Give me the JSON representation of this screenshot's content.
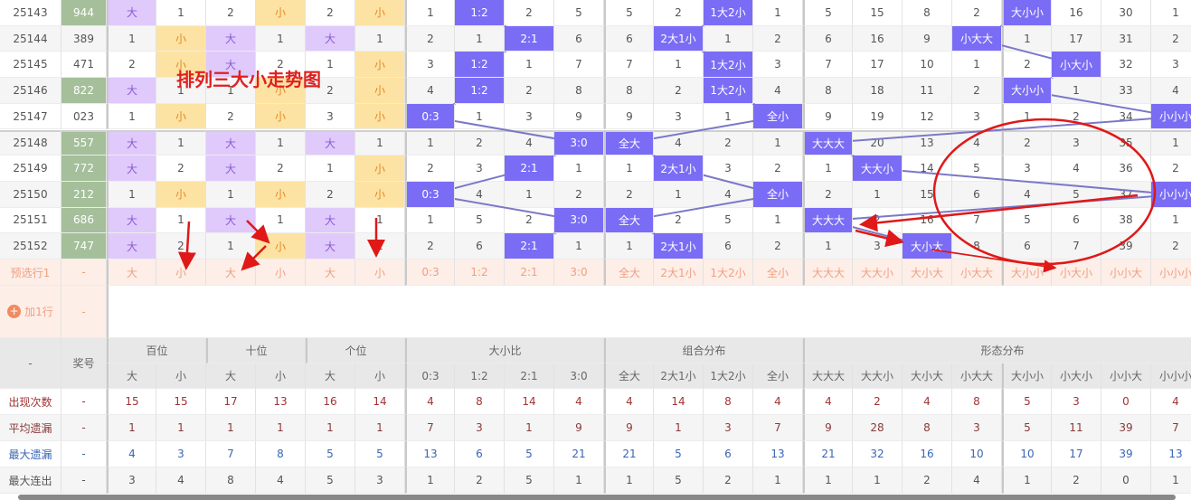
{
  "title": "排列三大小走势图",
  "rows": [
    {
      "issue": "25143",
      "number": "944",
      "green": true,
      "cells": [
        "大",
        "1",
        "2",
        "小",
        "2",
        "小",
        "1",
        "1:2",
        "2",
        "5",
        "5",
        "2",
        "1大2小",
        "1",
        "5",
        "15",
        "8",
        "2",
        "大小小",
        "16",
        "30",
        "1"
      ]
    },
    {
      "issue": "25144",
      "number": "389",
      "green": false,
      "cells": [
        "1",
        "小",
        "大",
        "1",
        "大",
        "1",
        "2",
        "1",
        "2:1",
        "6",
        "6",
        "2大1小",
        "1",
        "2",
        "6",
        "16",
        "9",
        "小大大",
        "1",
        "17",
        "31",
        "2"
      ]
    },
    {
      "issue": "25145",
      "number": "471",
      "green": false,
      "cells": [
        "2",
        "小",
        "大",
        "2",
        "1",
        "小",
        "3",
        "1:2",
        "1",
        "7",
        "7",
        "1",
        "1大2小",
        "3",
        "7",
        "17",
        "10",
        "1",
        "2",
        "小大小",
        "32",
        "3"
      ]
    },
    {
      "issue": "25146",
      "number": "822",
      "green": true,
      "cells": [
        "大",
        "1",
        "1",
        "小",
        "2",
        "小",
        "4",
        "1:2",
        "2",
        "8",
        "8",
        "2",
        "1大2小",
        "4",
        "8",
        "18",
        "11",
        "2",
        "大小小",
        "1",
        "33",
        "4"
      ]
    },
    {
      "issue": "25147",
      "number": "023",
      "green": false,
      "cells": [
        "1",
        "小",
        "2",
        "小",
        "3",
        "小",
        "0:3",
        "1",
        "3",
        "9",
        "9",
        "3",
        "1",
        "全小",
        "9",
        "19",
        "12",
        "3",
        "1",
        "2",
        "34",
        "小小小"
      ]
    },
    {
      "issue": "25148",
      "number": "557",
      "green": true,
      "cells": [
        "大",
        "1",
        "大",
        "1",
        "大",
        "1",
        "1",
        "2",
        "4",
        "3:0",
        "全大",
        "4",
        "2",
        "1",
        "大大大",
        "20",
        "13",
        "4",
        "2",
        "3",
        "35",
        "1"
      ]
    },
    {
      "issue": "25149",
      "number": "772",
      "green": true,
      "cells": [
        "大",
        "2",
        "大",
        "2",
        "1",
        "小",
        "2",
        "3",
        "2:1",
        "1",
        "1",
        "2大1小",
        "3",
        "2",
        "1",
        "大大小",
        "14",
        "5",
        "3",
        "4",
        "36",
        "2"
      ]
    },
    {
      "issue": "25150",
      "number": "212",
      "green": true,
      "cells": [
        "1",
        "小",
        "1",
        "小",
        "2",
        "小",
        "0:3",
        "4",
        "1",
        "2",
        "2",
        "1",
        "4",
        "全小",
        "2",
        "1",
        "15",
        "6",
        "4",
        "5",
        "37",
        "小小小"
      ]
    },
    {
      "issue": "25151",
      "number": "686",
      "green": true,
      "cells": [
        "大",
        "1",
        "大",
        "1",
        "大",
        "1",
        "1",
        "5",
        "2",
        "3:0",
        "全大",
        "2",
        "5",
        "1",
        "大大大",
        "2",
        "16",
        "7",
        "5",
        "6",
        "38",
        "1"
      ]
    },
    {
      "issue": "25152",
      "number": "747",
      "green": true,
      "cells": [
        "大",
        "2",
        "1",
        "小",
        "大",
        "2",
        "2",
        "6",
        "2:1",
        "1",
        "1",
        "2大1小",
        "6",
        "2",
        "1",
        "3",
        "大小大",
        "8",
        "6",
        "7",
        "39",
        "2"
      ]
    }
  ],
  "preselect": {
    "label": "预选行1",
    "number": "-",
    "cells": [
      "大",
      "小",
      "大",
      "小",
      "大",
      "小",
      "0:3",
      "1:2",
      "2:1",
      "3:0",
      "全大",
      "2大1小",
      "1大2小",
      "全小",
      "大大大",
      "大大小",
      "大小大",
      "小大大",
      "大小小",
      "小大小",
      "小小大",
      "小小小"
    ]
  },
  "add_row": {
    "label": "加1行",
    "number": "-"
  },
  "header": {
    "corner": "-",
    "number": "奖号",
    "groups": [
      "百位",
      "十位",
      "个位",
      "大小比",
      "组合分布",
      "形态分布"
    ],
    "sub": [
      "大",
      "小",
      "大",
      "小",
      "大",
      "小",
      "0:3",
      "1:2",
      "2:1",
      "3:0",
      "全大",
      "2大1小",
      "1大2小",
      "全小",
      "大大大",
      "大大小",
      "大小大",
      "小大大",
      "大小小",
      "小大小",
      "小小大",
      "小小小"
    ]
  },
  "stats": [
    {
      "label": "出现次数",
      "number": "-",
      "values": [
        "15",
        "15",
        "17",
        "13",
        "16",
        "14",
        "4",
        "8",
        "14",
        "4",
        "4",
        "14",
        "8",
        "4",
        "4",
        "2",
        "4",
        "8",
        "5",
        "3",
        "0",
        "4"
      ]
    },
    {
      "label": "平均遗漏",
      "number": "-",
      "values": [
        "1",
        "1",
        "1",
        "1",
        "1",
        "1",
        "7",
        "3",
        "1",
        "9",
        "9",
        "1",
        "3",
        "7",
        "9",
        "28",
        "8",
        "3",
        "5",
        "11",
        "39",
        "7"
      ]
    },
    {
      "label": "最大遗漏",
      "number": "-",
      "values": [
        "4",
        "3",
        "7",
        "8",
        "5",
        "5",
        "13",
        "6",
        "5",
        "21",
        "21",
        "5",
        "6",
        "13",
        "21",
        "32",
        "16",
        "10",
        "10",
        "17",
        "39",
        "13"
      ]
    },
    {
      "label": "最大连出",
      "number": "-",
      "values": [
        "3",
        "4",
        "8",
        "4",
        "5",
        "3",
        "1",
        "2",
        "5",
        "1",
        "1",
        "5",
        "2",
        "1",
        "1",
        "1",
        "2",
        "4",
        "1",
        "2",
        "0",
        "1"
      ]
    }
  ]
}
